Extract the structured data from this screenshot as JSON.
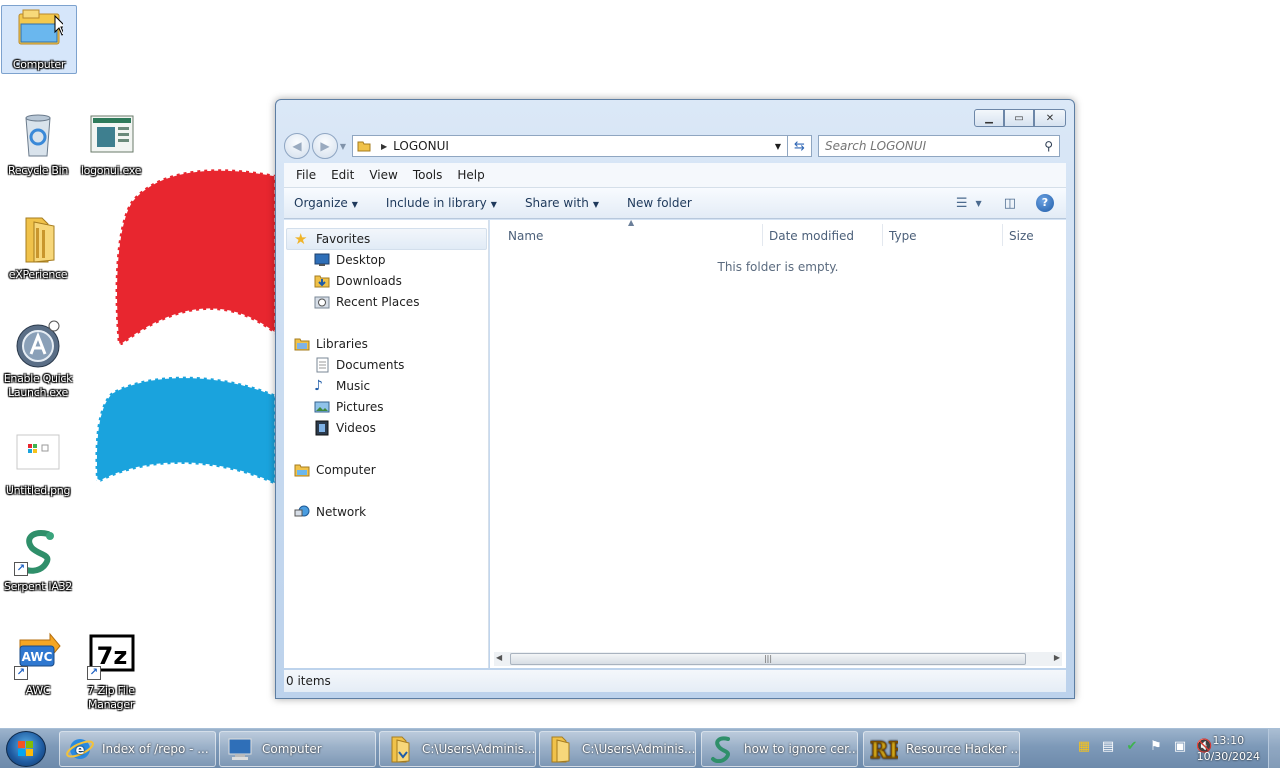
{
  "desktop": {
    "icons": [
      {
        "label": "Computer",
        "icon": "computer-icon"
      },
      {
        "label": "Recycle Bin",
        "icon": "recycle-bin-icon"
      },
      {
        "label": "logonui.exe",
        "icon": "exe-file-icon"
      },
      {
        "label": "eXPerience",
        "icon": "folder-icon"
      },
      {
        "label": "Enable Quick Launch.exe",
        "icon": "quick-launch-icon"
      },
      {
        "label": "Untitled.png",
        "icon": "image-file-icon"
      },
      {
        "label": "Serpent IA32",
        "icon": "serpent-icon"
      },
      {
        "label": "AWC",
        "icon": "awc-icon"
      },
      {
        "label": "7-Zip File Manager",
        "icon": "sevenzip-icon"
      }
    ]
  },
  "window": {
    "address_crumb": "LOGONUI",
    "search_placeholder": "Search LOGONUI",
    "menu": [
      "File",
      "Edit",
      "View",
      "Tools",
      "Help"
    ],
    "toolbar": {
      "organize": "Organize",
      "include_in_library": "Include in library",
      "share_with": "Share with",
      "new_folder": "New folder"
    },
    "nav": {
      "favorites": "Favorites",
      "desktop": "Desktop",
      "downloads": "Downloads",
      "recent_places": "Recent Places",
      "libraries": "Libraries",
      "documents": "Documents",
      "music": "Music",
      "pictures": "Pictures",
      "videos": "Videos",
      "computer": "Computer",
      "network": "Network"
    },
    "columns": {
      "name": "Name",
      "date_modified": "Date modified",
      "type": "Type",
      "size": "Size"
    },
    "empty_message": "This folder is empty.",
    "status": "0 items"
  },
  "taskbar": {
    "tasks": [
      {
        "label": "Index of /repo - ...",
        "icon": "internet-explorer-icon"
      },
      {
        "label": "Computer",
        "icon": "computer-icon"
      },
      {
        "label": "C:\\Users\\Adminis...",
        "icon": "folder-icon"
      },
      {
        "label": "C:\\Users\\Adminis...",
        "icon": "folder-icon"
      },
      {
        "label": "how to ignore cer...",
        "icon": "serpent-icon"
      },
      {
        "label": "Resource Hacker ...",
        "icon": "resource-hacker-icon"
      }
    ],
    "clock": {
      "time": "13:10",
      "date": "10/30/2024"
    }
  },
  "colors": {
    "wallpaper_red": "#e8262f",
    "wallpaper_blue": "#1aa3dd",
    "taskbar": "#7d99b8"
  }
}
